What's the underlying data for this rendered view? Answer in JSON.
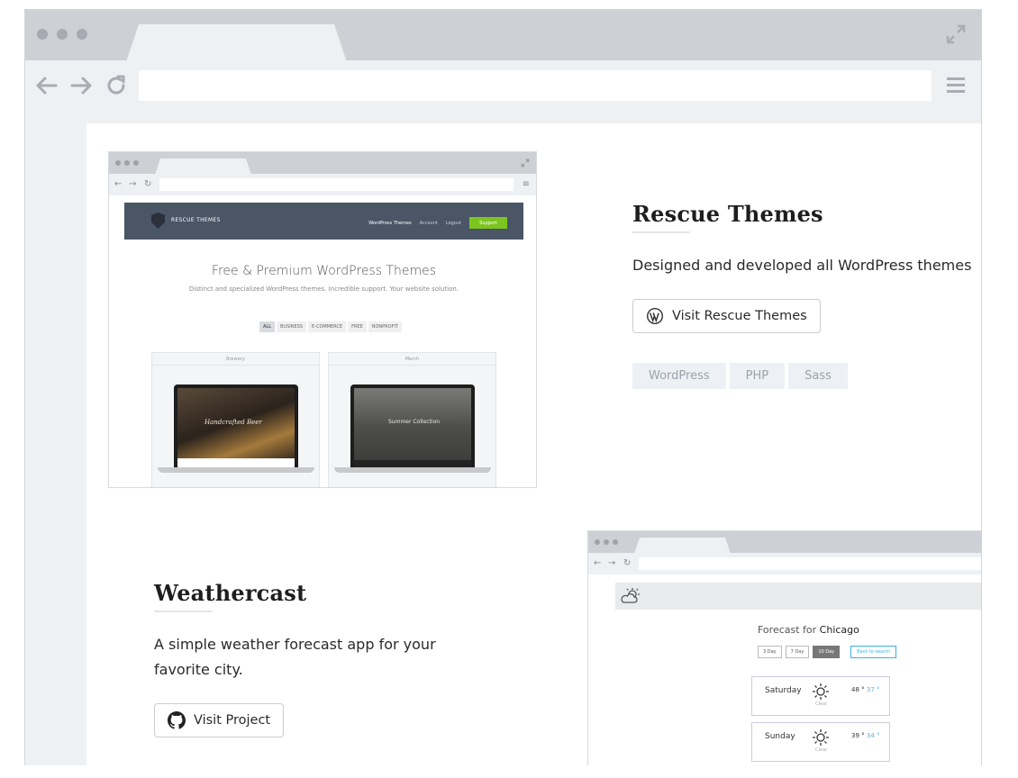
{
  "colors": {
    "frame": "#cdd0d4",
    "chrome": "#eef1f4",
    "tag_bg": "#edf0f4",
    "tag_text": "#9aa3ad",
    "support_green": "#7cc520",
    "rt_header": "#4a5566",
    "wc_link": "#39b3e6"
  },
  "icons": {
    "back": "arrow-left-icon",
    "forward": "arrow-right-icon",
    "reload": "reload-icon",
    "menu": "hamburger-menu-icon",
    "expand": "expand-icon",
    "wordpress": "wordpress-icon",
    "github": "github-icon",
    "weather": "partly-cloudy-icon",
    "sun": "sun-icon"
  },
  "projects": [
    {
      "title": "Rescue Themes",
      "description": "Designed and developed all WordPress themes",
      "button_label": "Visit Rescue Themes",
      "tags": [
        "WordPress",
        "PHP",
        "Sass"
      ]
    },
    {
      "title": "Weathercast",
      "description_line1": "A simple weather forecast app for your",
      "description_line2": "favorite city.",
      "button_label": "Visit Project"
    }
  ],
  "rescue_site": {
    "logo_text": "RESCUE THEMES",
    "nav": {
      "themes": "WordPress Themes",
      "account": "Account",
      "logout": "Logout",
      "support": "Support"
    },
    "headline": "Free & Premium WordPress Themes",
    "subheadline": "Distinct and specialized WordPress themes. Incredible support. Your website solution.",
    "filters": [
      "ALL",
      "BUSINESS",
      "E-COMMERCE",
      "FREE",
      "NONPROFIT"
    ],
    "cards": [
      {
        "label": "Brewery",
        "screen_text": "Handcrafted Beer"
      },
      {
        "label": "Merch",
        "screen_text": "Summer Collection"
      }
    ]
  },
  "weather_site": {
    "forecast_prefix": "Forecast for",
    "city": "Chicago",
    "range_buttons": [
      "3 Day",
      "7 Day",
      "10 Day"
    ],
    "back_button": "Back to search",
    "days": [
      {
        "name": "Saturday",
        "condition": "Clear",
        "high": "48 °",
        "low": "37 °"
      },
      {
        "name": "Sunday",
        "condition": "Clear",
        "high": "39 °",
        "low": "34 °"
      }
    ]
  }
}
